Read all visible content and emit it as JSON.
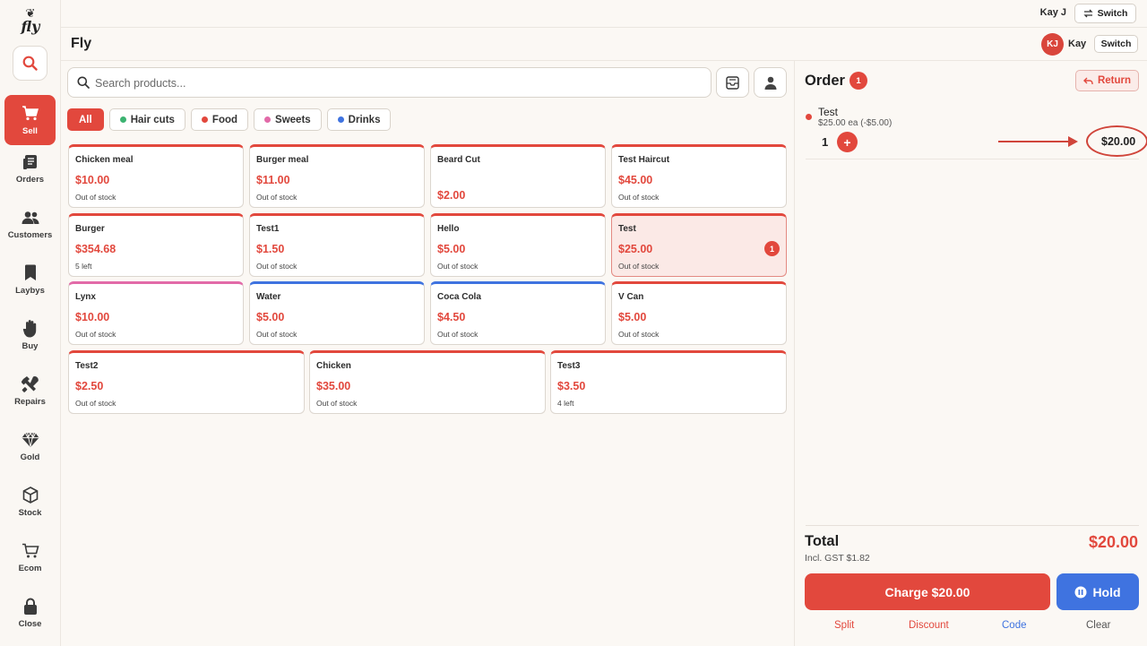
{
  "brand": {
    "logo_text": "fly"
  },
  "sidebar": {
    "items": [
      {
        "label": "Sell",
        "icon": "cart-icon"
      },
      {
        "label": "Orders",
        "icon": "orders-icon"
      },
      {
        "label": "Customers",
        "icon": "customers-icon"
      },
      {
        "label": "Laybys",
        "icon": "bookmark-icon"
      },
      {
        "label": "Buy",
        "icon": "hand-icon"
      },
      {
        "label": "Repairs",
        "icon": "tools-icon"
      },
      {
        "label": "Gold",
        "icon": "gem-icon"
      },
      {
        "label": "Stock",
        "icon": "box-icon"
      },
      {
        "label": "Ecom",
        "icon": "ecom-cart-icon"
      },
      {
        "label": "Close",
        "icon": "lock-icon"
      }
    ]
  },
  "topbar": {
    "user": "Kay J",
    "switch_label": "Switch"
  },
  "titlebar": {
    "title": "Fly",
    "avatar_initials": "KJ",
    "user": "Kay",
    "switch_label": "Switch"
  },
  "search": {
    "placeholder": "Search products..."
  },
  "categories": [
    {
      "label": "All",
      "color": ""
    },
    {
      "label": "Hair cuts",
      "color": "#3cb371"
    },
    {
      "label": "Food",
      "color": "#e2483d"
    },
    {
      "label": "Sweets",
      "color": "#e26aa8"
    },
    {
      "label": "Drinks",
      "color": "#3f73e0"
    }
  ],
  "products": [
    {
      "name": "Chicken meal",
      "price": "$10.00",
      "stock": "Out of stock"
    },
    {
      "name": "Burger meal",
      "price": "$11.00",
      "stock": "Out of stock"
    },
    {
      "name": "Beard Cut",
      "price": "$2.00",
      "stock": ""
    },
    {
      "name": "Test Haircut",
      "price": "$45.00",
      "stock": "Out of stock"
    },
    {
      "name": "Burger",
      "price": "$354.68",
      "stock": "5 left"
    },
    {
      "name": "Test1",
      "price": "$1.50",
      "stock": "Out of stock"
    },
    {
      "name": "Hello",
      "price": "$5.00",
      "stock": "Out of stock"
    },
    {
      "name": "Test",
      "price": "$25.00",
      "stock": "Out of stock",
      "badge": "1"
    },
    {
      "name": "Lynx",
      "price": "$10.00",
      "stock": "Out of stock"
    },
    {
      "name": "Water",
      "price": "$5.00",
      "stock": "Out of stock"
    },
    {
      "name": "Coca Cola",
      "price": "$4.50",
      "stock": "Out of stock"
    },
    {
      "name": "V Can",
      "price": "$5.00",
      "stock": "Out of stock"
    },
    {
      "name": "Test2",
      "price": "$2.50",
      "stock": "Out of stock"
    },
    {
      "name": "Chicken",
      "price": "$35.00",
      "stock": "Out of stock"
    },
    {
      "name": "Test3",
      "price": "$3.50",
      "stock": "4 left"
    }
  ],
  "colors": {
    "accent": "#e2483d",
    "hold": "#3f73e0",
    "drinks": "#3f73e0",
    "sweets": "#e26aa8"
  },
  "order": {
    "title": "Order",
    "count": "1",
    "return_label": "Return",
    "line": {
      "name": "Test",
      "detail": "$25.00 ea (-$5.00)",
      "qty": "1",
      "total": "$20.00"
    },
    "total_label": "Total",
    "gst_label": "Incl. GST $1.82",
    "total_value": "$20.00",
    "charge_label": "Charge $20.00",
    "hold_label": "Hold",
    "footer": {
      "split": "Split",
      "discount": "Discount",
      "code": "Code",
      "clear": "Clear"
    }
  }
}
